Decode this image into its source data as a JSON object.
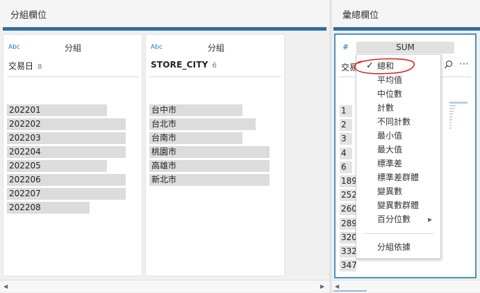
{
  "group_panel": {
    "title": "分組欄位"
  },
  "agg_panel": {
    "title": "彙總欄位"
  },
  "card1": {
    "type_icon": "Abc",
    "group_label": "分組",
    "field": "交易日",
    "count": "8",
    "values": [
      "202201",
      "202202",
      "202203",
      "202204",
      "202205",
      "202206",
      "202207",
      "202208"
    ],
    "bar_fill": [
      0.81,
      0.96,
      0.96,
      0.96,
      0.81,
      0.96,
      0.96,
      0.67
    ]
  },
  "card2": {
    "type_icon": "Abc",
    "group_label": "分組",
    "field": "STORE_CITY",
    "count": "6",
    "values": [
      "台中市",
      "台北市",
      "台南市",
      "桃園市",
      "高雄市",
      "新北市"
    ],
    "bar_fill": [
      0.75,
      0.86,
      0.75,
      0.97,
      0.97,
      0.97
    ]
  },
  "card3": {
    "type_icon": "#",
    "agg_label": "SUM",
    "field": "交易",
    "values": [
      "1",
      "2",
      "3",
      "4",
      "6",
      "189",
      "252",
      "260",
      "289",
      "320",
      "332",
      "347"
    ]
  },
  "menu": {
    "items": [
      {
        "label": "總和",
        "checked": true
      },
      {
        "label": "平均值"
      },
      {
        "label": "中位數"
      },
      {
        "label": "計數"
      },
      {
        "label": "不同計數"
      },
      {
        "label": "最小值"
      },
      {
        "label": "最大值"
      },
      {
        "label": "標準差"
      },
      {
        "label": "標準差群體"
      },
      {
        "label": "變異數"
      },
      {
        "label": "變異數群體"
      },
      {
        "label": "百分位數",
        "submenu": true
      }
    ],
    "footer_item": "分組依據",
    "checkmark": "✓",
    "submenu_arrow": "▶"
  },
  "icons": {
    "search": "search-icon",
    "more": "more-icon"
  },
  "colors": {
    "accent_bar": "#2f6f9f",
    "highlight_blue": "#4a90c8",
    "annotation_red": "#e02020"
  }
}
